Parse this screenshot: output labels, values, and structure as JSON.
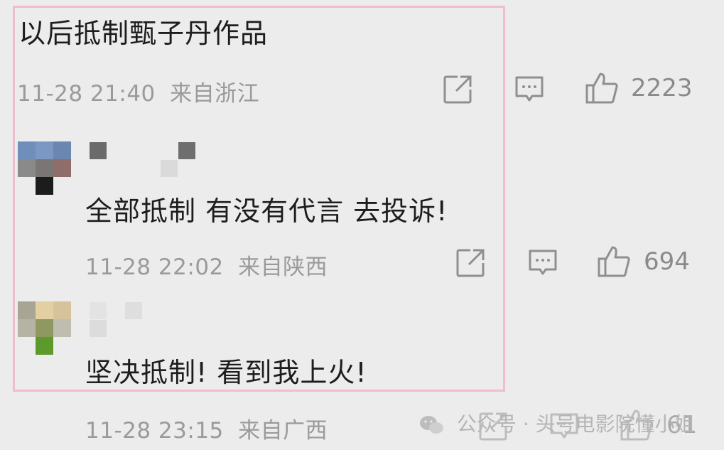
{
  "comments": [
    {
      "text": "以后抵制甄子丹作品",
      "time": "11-28 21:40",
      "location": "来自浙江",
      "likes": "2223"
    },
    {
      "text": "全部抵制 有没有代言 去投诉!",
      "time": "11-28 22:02",
      "location": "来自陕西",
      "likes": "694"
    },
    {
      "text": "坚决抵制! 看到我上火!",
      "time": "11-28 23:15",
      "location": "来自广西",
      "likes": "61"
    }
  ],
  "watermark": {
    "text": "公众号 · 头号电影院懂小姐"
  },
  "icons": {
    "share": "share-icon",
    "comment": "comment-icon",
    "like": "thumbs-up-icon",
    "watermark": "wechat-icon"
  },
  "colors": {
    "background": "#ececec",
    "highlight_border": "#eebfc8",
    "meta_text": "#9a9a9a",
    "icon": "#8f8f8f"
  }
}
